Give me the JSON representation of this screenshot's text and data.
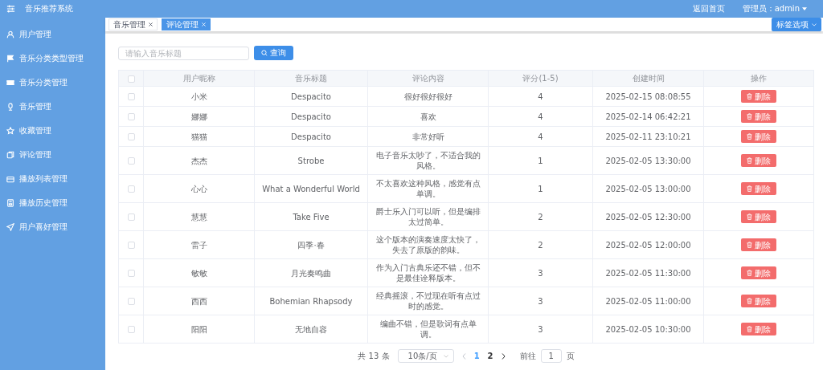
{
  "header": {
    "title": "音乐推荐系统",
    "home_link": "返回首页",
    "user": "管理员：admin"
  },
  "sidebar": {
    "items": [
      {
        "label": "用户管理"
      },
      {
        "label": "音乐分类类型管理"
      },
      {
        "label": "音乐分类管理"
      },
      {
        "label": "音乐管理"
      },
      {
        "label": "收藏管理"
      },
      {
        "label": "评论管理"
      },
      {
        "label": "播放列表管理"
      },
      {
        "label": "播放历史管理"
      },
      {
        "label": "用户喜好管理"
      }
    ]
  },
  "tabs": [
    {
      "label": "音乐管理",
      "selected": false
    },
    {
      "label": "评论管理",
      "selected": true
    }
  ],
  "tab_options": "标签选项",
  "search": {
    "placeholder": "请输入音乐标题",
    "button": "查询"
  },
  "table": {
    "all_checked": false,
    "columns": [
      "用户昵称",
      "音乐标题",
      "评论内容",
      "评分(1-5)",
      "创建时间",
      "操作"
    ],
    "rows": [
      {
        "checked": false,
        "nickname": "小米",
        "title": "Despacito",
        "comment": "很好很好很好",
        "score": "4",
        "created": "2025-02-15 08:08:55",
        "action": "删除"
      },
      {
        "checked": false,
        "nickname": "娜娜",
        "title": "Despacito",
        "comment": "喜欢",
        "score": "4",
        "created": "2025-02-14 06:42:21",
        "action": "删除"
      },
      {
        "checked": false,
        "nickname": "猫猫",
        "title": "Despacito",
        "comment": "非常好听",
        "score": "4",
        "created": "2025-02-11 23:10:21",
        "action": "删除"
      },
      {
        "checked": false,
        "nickname": "杰杰",
        "title": "Strobe",
        "comment": "电子音乐太吵了，不适合我的风格。",
        "score": "1",
        "created": "2025-02-05 13:30:00",
        "action": "删除"
      },
      {
        "checked": false,
        "nickname": "心心",
        "title": "What a Wonderful World",
        "comment": "不太喜欢这种风格，感觉有点单调。",
        "score": "1",
        "created": "2025-02-05 13:00:00",
        "action": "删除"
      },
      {
        "checked": false,
        "nickname": "慧慧",
        "title": "Take Five",
        "comment": "爵士乐入门可以听，但是编排太过简单。",
        "score": "2",
        "created": "2025-02-05 12:30:00",
        "action": "删除"
      },
      {
        "checked": false,
        "nickname": "雷子",
        "title": "四季·春",
        "comment": "这个版本的演奏速度太快了，失去了原版的韵味。",
        "score": "2",
        "created": "2025-02-05 12:00:00",
        "action": "删除"
      },
      {
        "checked": false,
        "nickname": "敏敏",
        "title": "月光奏鸣曲",
        "comment": "作为入门古典乐还不错，但不是最佳诠释版本。",
        "score": "3",
        "created": "2025-02-05 11:30:00",
        "action": "删除"
      },
      {
        "checked": false,
        "nickname": "西西",
        "title": "Bohemian Rhapsody",
        "comment": "经典摇滚，不过现在听有点过时的感觉。",
        "score": "3",
        "created": "2025-02-05 11:00:00",
        "action": "删除"
      },
      {
        "checked": false,
        "nickname": "阳阳",
        "title": "无地自容",
        "comment": "编曲不错，但是歌词有点单调。",
        "score": "3",
        "created": "2025-02-05 10:30:00",
        "action": "删除"
      }
    ]
  },
  "pagination": {
    "total": "共 13 条",
    "page_size": "10条/页",
    "pages": [
      {
        "label": "1",
        "selected": true
      },
      {
        "label": "2",
        "selected": false
      }
    ],
    "goto_label": "前往",
    "goto_value": "1",
    "goto_suffix": "页"
  }
}
